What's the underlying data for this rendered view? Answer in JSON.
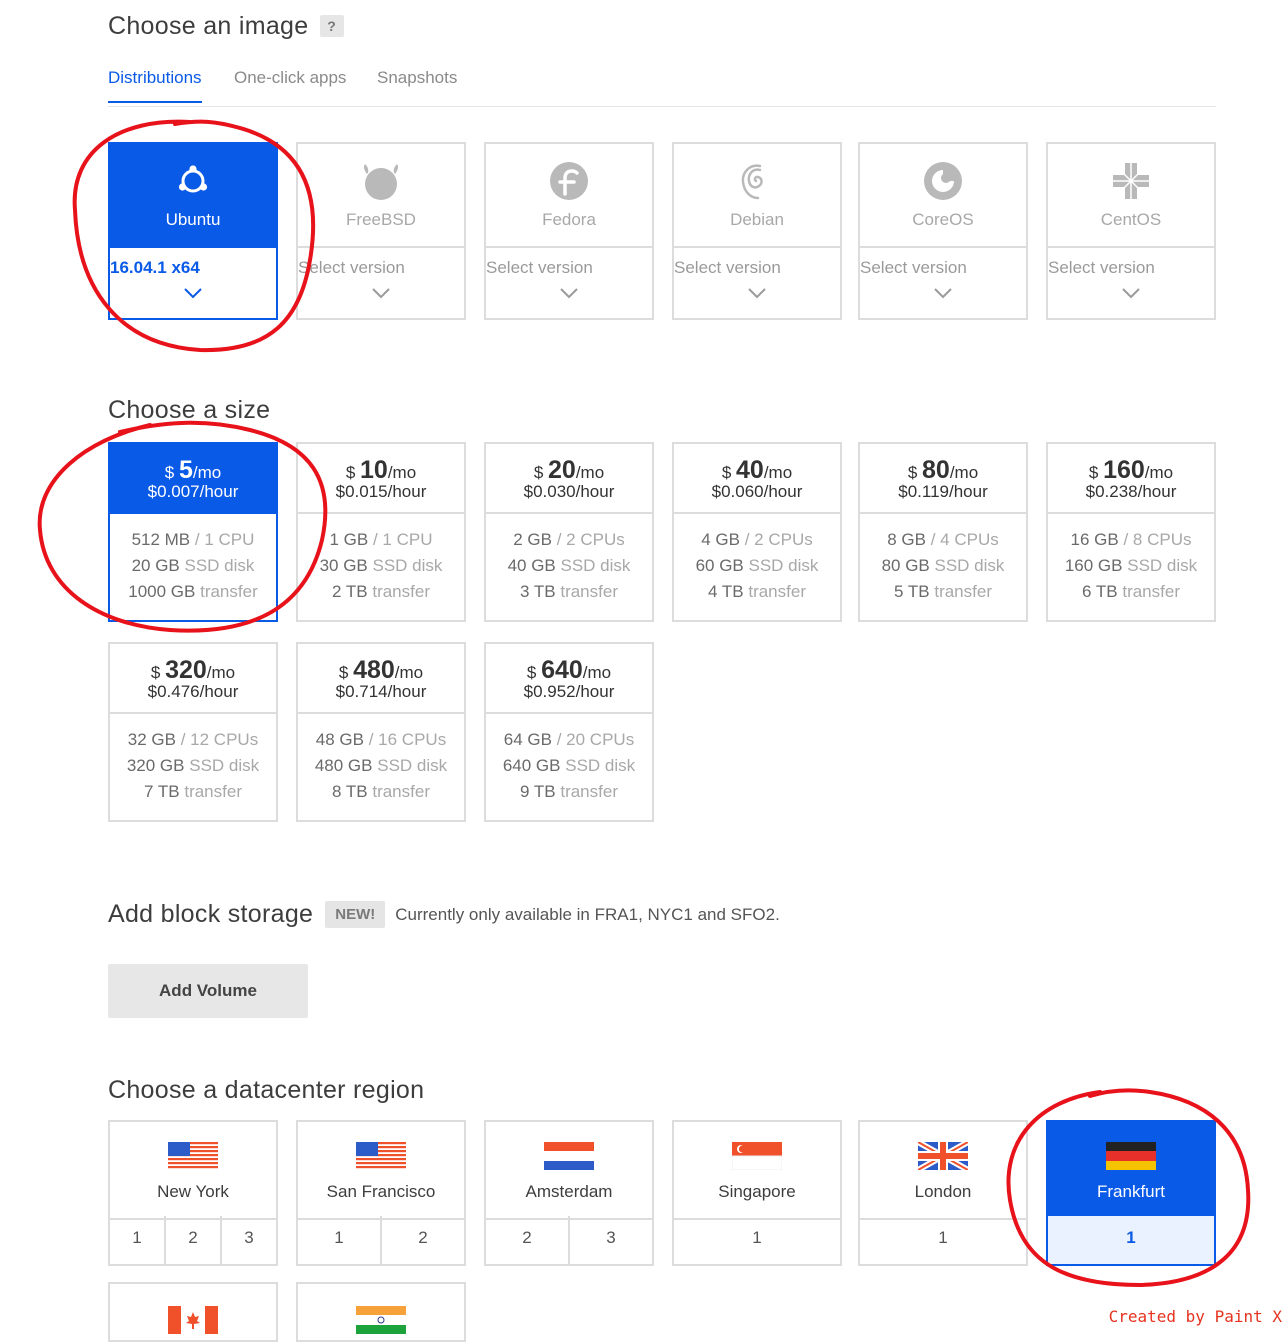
{
  "image_section": {
    "title": "Choose an image",
    "help": "?",
    "tabs": [
      "Distributions",
      "One-click apps",
      "Snapshots"
    ],
    "distros": [
      {
        "name": "Ubuntu",
        "version": "16.04.1 x64",
        "selected": true,
        "icon": "ubuntu-icon"
      },
      {
        "name": "FreeBSD",
        "version": "Select version",
        "selected": false,
        "icon": "freebsd-icon"
      },
      {
        "name": "Fedora",
        "version": "Select version",
        "selected": false,
        "icon": "fedora-icon"
      },
      {
        "name": "Debian",
        "version": "Select version",
        "selected": false,
        "icon": "debian-icon"
      },
      {
        "name": "CoreOS",
        "version": "Select version",
        "selected": false,
        "icon": "coreos-icon"
      },
      {
        "name": "CentOS",
        "version": "Select version",
        "selected": false,
        "icon": "centos-icon"
      }
    ]
  },
  "size_section": {
    "title": "Choose a size",
    "plans": [
      {
        "dollar": "$",
        "price": "5",
        "per": "/mo",
        "hour": "$0.007/hour",
        "mem": "512 MB",
        "cpu": "/ 1 CPU",
        "disk": "20 GB",
        "disk_unit": "SSD disk",
        "transfer": "1000 GB",
        "transfer_unit": "transfer",
        "selected": true
      },
      {
        "dollar": "$",
        "price": "10",
        "per": "/mo",
        "hour": "$0.015/hour",
        "mem": "1 GB",
        "cpu": "/ 1 CPU",
        "disk": "30 GB",
        "disk_unit": "SSD disk",
        "transfer": "2 TB",
        "transfer_unit": "transfer",
        "selected": false
      },
      {
        "dollar": "$",
        "price": "20",
        "per": "/mo",
        "hour": "$0.030/hour",
        "mem": "2 GB",
        "cpu": "/ 2 CPUs",
        "disk": "40 GB",
        "disk_unit": "SSD disk",
        "transfer": "3 TB",
        "transfer_unit": "transfer",
        "selected": false
      },
      {
        "dollar": "$",
        "price": "40",
        "per": "/mo",
        "hour": "$0.060/hour",
        "mem": "4 GB",
        "cpu": "/ 2 CPUs",
        "disk": "60 GB",
        "disk_unit": "SSD disk",
        "transfer": "4 TB",
        "transfer_unit": "transfer",
        "selected": false
      },
      {
        "dollar": "$",
        "price": "80",
        "per": "/mo",
        "hour": "$0.119/hour",
        "mem": "8 GB",
        "cpu": "/ 4 CPUs",
        "disk": "80 GB",
        "disk_unit": "SSD disk",
        "transfer": "5 TB",
        "transfer_unit": "transfer",
        "selected": false
      },
      {
        "dollar": "$",
        "price": "160",
        "per": "/mo",
        "hour": "$0.238/hour",
        "mem": "16 GB",
        "cpu": "/ 8 CPUs",
        "disk": "160 GB",
        "disk_unit": "SSD disk",
        "transfer": "6 TB",
        "transfer_unit": "transfer",
        "selected": false
      },
      {
        "dollar": "$",
        "price": "320",
        "per": "/mo",
        "hour": "$0.476/hour",
        "mem": "32 GB",
        "cpu": "/ 12 CPUs",
        "disk": "320 GB",
        "disk_unit": "SSD disk",
        "transfer": "7 TB",
        "transfer_unit": "transfer",
        "selected": false
      },
      {
        "dollar": "$",
        "price": "480",
        "per": "/mo",
        "hour": "$0.714/hour",
        "mem": "48 GB",
        "cpu": "/ 16 CPUs",
        "disk": "480 GB",
        "disk_unit": "SSD disk",
        "transfer": "8 TB",
        "transfer_unit": "transfer",
        "selected": false
      },
      {
        "dollar": "$",
        "price": "640",
        "per": "/mo",
        "hour": "$0.952/hour",
        "mem": "64 GB",
        "cpu": "/ 20 CPUs",
        "disk": "640 GB",
        "disk_unit": "SSD disk",
        "transfer": "9 TB",
        "transfer_unit": "transfer",
        "selected": false
      }
    ]
  },
  "storage_section": {
    "title": "Add block storage",
    "badge": "NEW!",
    "note": "Currently only available in FRA1, NYC1 and SFO2.",
    "button": "Add Volume"
  },
  "region_section": {
    "title": "Choose a datacenter region",
    "regions": [
      {
        "name": "New York",
        "flag": "us-flag-icon",
        "numbers": [
          "1",
          "2",
          "3"
        ],
        "selected": false
      },
      {
        "name": "San Francisco",
        "flag": "us-flag-icon",
        "numbers": [
          "1",
          "2"
        ],
        "selected": false
      },
      {
        "name": "Amsterdam",
        "flag": "nl-flag-icon",
        "numbers": [
          "2",
          "3"
        ],
        "selected": false
      },
      {
        "name": "Singapore",
        "flag": "sg-flag-icon",
        "numbers": [
          "1"
        ],
        "selected": false
      },
      {
        "name": "London",
        "flag": "uk-flag-icon",
        "numbers": [
          "1"
        ],
        "selected": false
      },
      {
        "name": "Frankfurt",
        "flag": "de-flag-icon",
        "numbers": [
          "1"
        ],
        "selected": true
      }
    ],
    "more_flags": [
      "ca-flag-icon",
      "in-flag-icon"
    ]
  },
  "watermark": "Created by Paint X",
  "colors": {
    "accent": "#0a5ae8",
    "annotation": "#e8121b",
    "border": "#dcdcdc"
  }
}
